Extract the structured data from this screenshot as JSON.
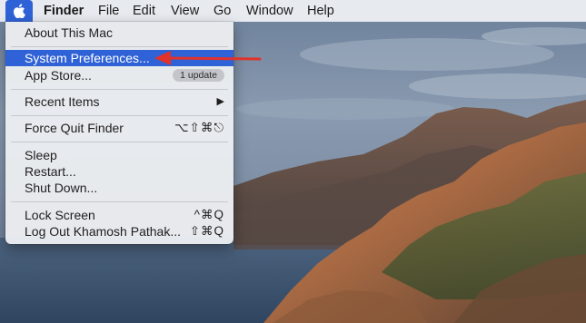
{
  "menubar": {
    "app_name": "Finder",
    "menus": [
      "File",
      "Edit",
      "View",
      "Go",
      "Window",
      "Help"
    ],
    "apple_icon": "apple-logo-icon"
  },
  "apple_menu": {
    "about": "About This Mac",
    "system_preferences": "System Preferences...",
    "app_store": "App Store...",
    "app_store_badge": "1 update",
    "recent_items": "Recent Items",
    "recent_items_arrow": "▶",
    "force_quit": "Force Quit Finder",
    "force_quit_shortcut": "⌥⇧⌘⎋",
    "sleep": "Sleep",
    "restart": "Restart...",
    "shut_down": "Shut Down...",
    "lock_screen": "Lock Screen",
    "lock_screen_shortcut": "^⌘Q",
    "log_out": "Log Out Khamosh Pathak...",
    "log_out_shortcut": "⇧⌘Q"
  },
  "annotation": {
    "arrow_color": "#e0322b"
  },
  "colors": {
    "selection": "#2f62d6"
  }
}
